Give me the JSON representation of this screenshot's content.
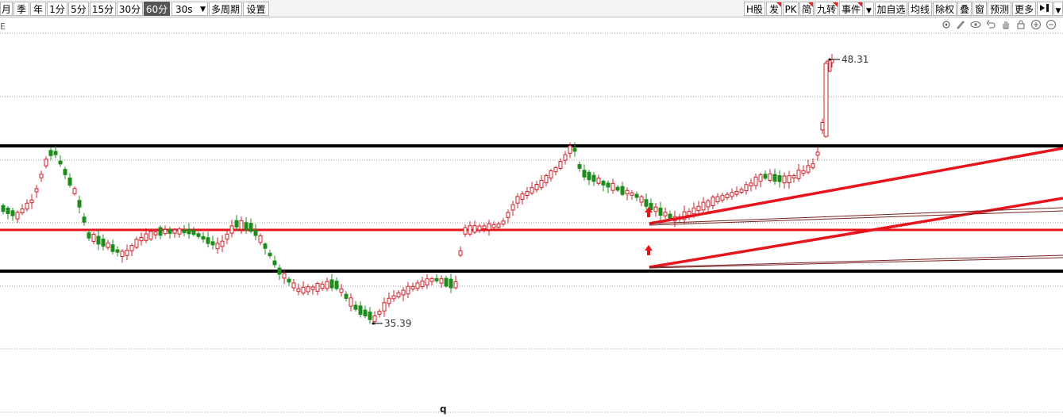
{
  "toolbar": {
    "periods": [
      "月",
      "季",
      "年",
      "1分",
      "5分",
      "15分",
      "30分",
      "60分"
    ],
    "active_period": "60分",
    "sub_select": "30s",
    "multi_period": "多周期",
    "settings": "设置",
    "right_buttons": [
      "H股",
      "发",
      "PK",
      "简",
      "九转",
      "事件",
      "加自选",
      "均线",
      "除权",
      "叠",
      "窗",
      "预测",
      "更多"
    ]
  },
  "left_glyph": "E",
  "tools": [
    "settings-icon",
    "brush-icon",
    "eye-icon",
    "undo-icon",
    "hand-icon",
    "lock-icon",
    "zoom-in-icon",
    "zoom-out-icon"
  ],
  "chart_data": {
    "type": "candlestick",
    "high_label": "48.31",
    "low_label": "35.39",
    "colors": {
      "up": "#d0202a",
      "down": "#1d8c1d",
      "drawn_line": "#e8141c",
      "support_line": "#000000"
    },
    "x_marker": "q"
  }
}
